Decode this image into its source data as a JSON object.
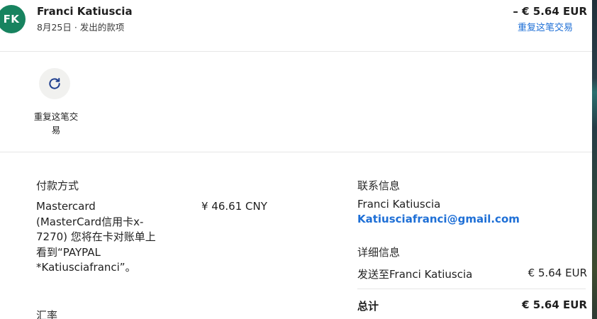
{
  "header": {
    "avatar_initials": "FK",
    "name": "Franci Katiuscia",
    "subtitle": "8月25日 · 发出的款项",
    "amount": "– € 5.64 EUR",
    "repeat_link": "重复这笔交易"
  },
  "actions": {
    "repeat_icon": "refresh-icon",
    "repeat_label": "重复这笔交易"
  },
  "payment": {
    "title": "付款方式",
    "method_description": "Mastercard (MasterCard信用卡x-7270) 您将在卡对账单上看到“PAYPAL *Katiusciafranci”。",
    "amount": "¥ 46.61 CNY",
    "rate_title": "汇率"
  },
  "contact": {
    "title": "联系信息",
    "name": "Franci Katiuscia",
    "email": "Katiusciafranci@gmail.com"
  },
  "details": {
    "title": "详细信息",
    "sent_to_label": "发送至Franci Katiuscia",
    "sent_to_amount": "€ 5.64 EUR",
    "total_label": "总计",
    "total_amount": "€ 5.64 EUR"
  },
  "colors": {
    "avatar_bg": "#17835f",
    "link": "#1e6fd6",
    "icon": "#1f3f8f"
  }
}
